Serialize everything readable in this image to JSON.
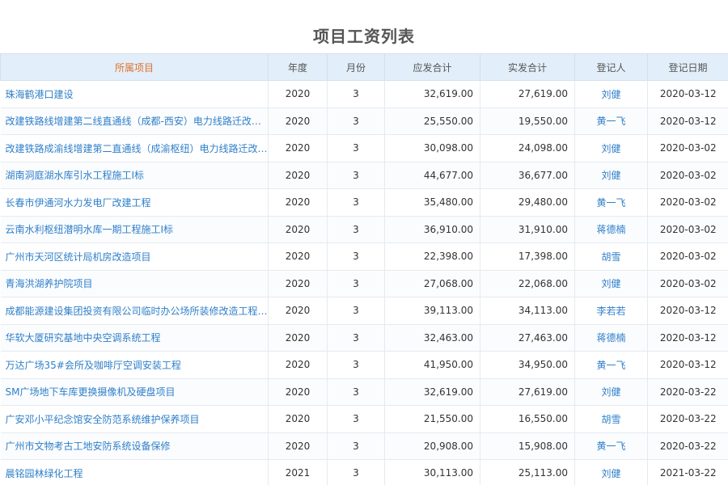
{
  "title": "项目工资列表",
  "columns": [
    "所属项目",
    "年度",
    "月份",
    "应发合计",
    "实发合计",
    "登记人",
    "登记日期"
  ],
  "rows": [
    {
      "project": "珠海鹤港口建设",
      "year": "2020",
      "month": "3",
      "payable": "32,619.00",
      "paid": "27,619.00",
      "registrant": "刘健",
      "date": "2020-03-12"
    },
    {
      "project": "改建铁路线增建第二线直通线（成都-西安）电力线路迁改工程",
      "year": "2020",
      "month": "3",
      "payable": "25,550.00",
      "paid": "19,550.00",
      "registrant": "黄一飞",
      "date": "2020-03-12"
    },
    {
      "project": "改建铁路成渝线增建第二直通线（成渝枢纽）电力线路迁改工程",
      "year": "2020",
      "month": "3",
      "payable": "30,098.00",
      "paid": "24,098.00",
      "registrant": "刘健",
      "date": "2020-03-02"
    },
    {
      "project": "湖南洞庭湖水库引水工程施工I标",
      "year": "2020",
      "month": "3",
      "payable": "44,677.00",
      "paid": "36,677.00",
      "registrant": "刘健",
      "date": "2020-03-02"
    },
    {
      "project": "长春市伊通河水力发电厂改建工程",
      "year": "2020",
      "month": "3",
      "payable": "35,480.00",
      "paid": "29,480.00",
      "registrant": "黄一飞",
      "date": "2020-03-02"
    },
    {
      "project": "云南水利枢纽潜明水库一期工程施工I标",
      "year": "2020",
      "month": "3",
      "payable": "36,910.00",
      "paid": "31,910.00",
      "registrant": "蒋德楠",
      "date": "2020-03-02"
    },
    {
      "project": "广州市天河区统计局机房改造项目",
      "year": "2020",
      "month": "3",
      "payable": "22,398.00",
      "paid": "17,398.00",
      "registrant": "胡雪",
      "date": "2020-03-02"
    },
    {
      "project": "青海洪湖养护院项目",
      "year": "2020",
      "month": "3",
      "payable": "27,068.00",
      "paid": "22,068.00",
      "registrant": "刘健",
      "date": "2020-03-02"
    },
    {
      "project": "成都能源建设集团投资有限公司临时办公场所装修改造工程项目",
      "year": "2020",
      "month": "3",
      "payable": "39,113.00",
      "paid": "34,113.00",
      "registrant": "李若若",
      "date": "2020-03-12"
    },
    {
      "project": "华软大厦研究基地中央空调系统工程",
      "year": "2020",
      "month": "3",
      "payable": "32,463.00",
      "paid": "27,463.00",
      "registrant": "蒋德楠",
      "date": "2020-03-12"
    },
    {
      "project": "万达广场35#会所及咖啡厅空调安装工程",
      "year": "2020",
      "month": "3",
      "payable": "41,950.00",
      "paid": "34,950.00",
      "registrant": "黄一飞",
      "date": "2020-03-12"
    },
    {
      "project": "SM广场地下车库更换摄像机及硬盘项目",
      "year": "2020",
      "month": "3",
      "payable": "32,619.00",
      "paid": "27,619.00",
      "registrant": "刘健",
      "date": "2020-03-22"
    },
    {
      "project": "广安邓小平纪念馆安全防范系统维护保养项目",
      "year": "2020",
      "month": "3",
      "payable": "21,550.00",
      "paid": "16,550.00",
      "registrant": "胡雪",
      "date": "2020-03-22"
    },
    {
      "project": "广州市文物考古工地安防系统设备保修",
      "year": "2020",
      "month": "3",
      "payable": "20,908.00",
      "paid": "15,908.00",
      "registrant": "黄一飞",
      "date": "2020-03-22"
    },
    {
      "project": "晨铭园林绿化工程",
      "year": "2021",
      "month": "3",
      "payable": "30,113.00",
      "paid": "25,113.00",
      "registrant": "刘健",
      "date": "2021-03-22"
    }
  ]
}
